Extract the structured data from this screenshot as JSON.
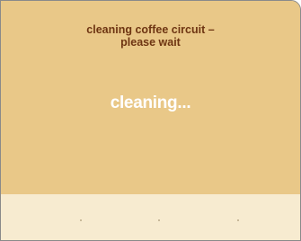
{
  "display": {
    "heading_line1": "cleaning coffee circuit –",
    "heading_line2": "please wait",
    "status_text": "cleaning..."
  },
  "soft_keys": [
    {
      "label": ""
    },
    {
      "label": ""
    },
    {
      "label": ""
    }
  ],
  "colors": {
    "display_background": "#e9c888",
    "heading_text": "#6e3512",
    "status_text": "#ffffff",
    "button_strip": "#f7ebd0"
  }
}
